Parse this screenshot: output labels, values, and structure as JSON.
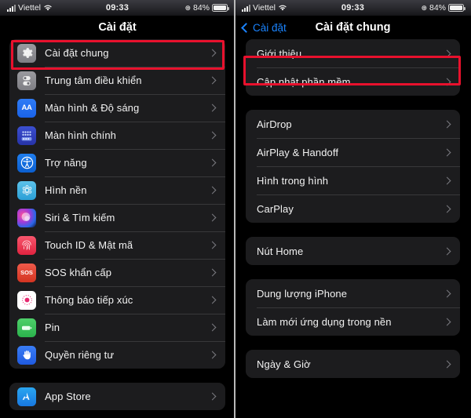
{
  "status_bar": {
    "carrier": "Viettel",
    "time": "09:33",
    "battery_percent": "84%",
    "signal_icon": "cellular-bars-icon",
    "wifi_icon": "wifi-icon",
    "lock_icon": "rotation-lock-icon",
    "battery_icon": "battery-icon"
  },
  "colors": {
    "accent": "#1a84ff",
    "highlight": "#e8112d",
    "card": "#1c1c1e",
    "background": "#000000",
    "separator": "#38383a",
    "label": "#f2f2f2"
  },
  "left_panel": {
    "nav": {
      "title": "Cài đặt"
    },
    "groups": [
      {
        "items": [
          {
            "label": "Cài đặt chung",
            "icon": "gear-icon",
            "highlighted": true
          },
          {
            "label": "Trung tâm điều khiển",
            "icon": "control-center-icon",
            "highlighted": false
          },
          {
            "label": "Màn hình & Độ sáng",
            "icon": "display-brightness-icon",
            "highlighted": false
          },
          {
            "label": "Màn hình chính",
            "icon": "home-screen-icon",
            "highlighted": false
          },
          {
            "label": "Trợ năng",
            "icon": "accessibility-icon",
            "highlighted": false
          },
          {
            "label": "Hình nền",
            "icon": "wallpaper-icon",
            "highlighted": false
          },
          {
            "label": "Siri & Tìm kiếm",
            "icon": "siri-icon",
            "highlighted": false
          },
          {
            "label": "Touch ID & Mật mã",
            "icon": "touch-id-icon",
            "highlighted": false
          },
          {
            "label": "SOS khẩn cấp",
            "icon": "sos-icon",
            "highlighted": false
          },
          {
            "label": "Thông báo tiếp xúc",
            "icon": "exposure-notification-icon",
            "highlighted": false
          },
          {
            "label": "Pin",
            "icon": "battery-icon",
            "highlighted": false
          },
          {
            "label": "Quyền riêng tư",
            "icon": "privacy-hand-icon",
            "highlighted": false
          }
        ]
      },
      {
        "items": [
          {
            "label": "App Store",
            "icon": "app-store-icon",
            "highlighted": false
          }
        ]
      }
    ]
  },
  "right_panel": {
    "nav": {
      "back_label": "Cài đặt",
      "title": "Cài đặt chung",
      "back_icon": "chevron-left-icon"
    },
    "groups": [
      {
        "items": [
          {
            "label": "Giới thiệu",
            "highlighted": true
          },
          {
            "label": "Cập nhật phần mềm",
            "highlighted": false
          }
        ]
      },
      {
        "items": [
          {
            "label": "AirDrop",
            "highlighted": false
          },
          {
            "label": "AirPlay & Handoff",
            "highlighted": false
          },
          {
            "label": "Hình trong hình",
            "highlighted": false
          },
          {
            "label": "CarPlay",
            "highlighted": false
          }
        ]
      },
      {
        "items": [
          {
            "label": "Nút Home",
            "highlighted": false
          }
        ]
      },
      {
        "items": [
          {
            "label": "Dung lượng iPhone",
            "highlighted": false
          },
          {
            "label": "Làm mới ứng dụng trong nền",
            "highlighted": false
          }
        ]
      },
      {
        "items": [
          {
            "label": "Ngày & Giờ",
            "highlighted": false
          }
        ]
      }
    ]
  }
}
